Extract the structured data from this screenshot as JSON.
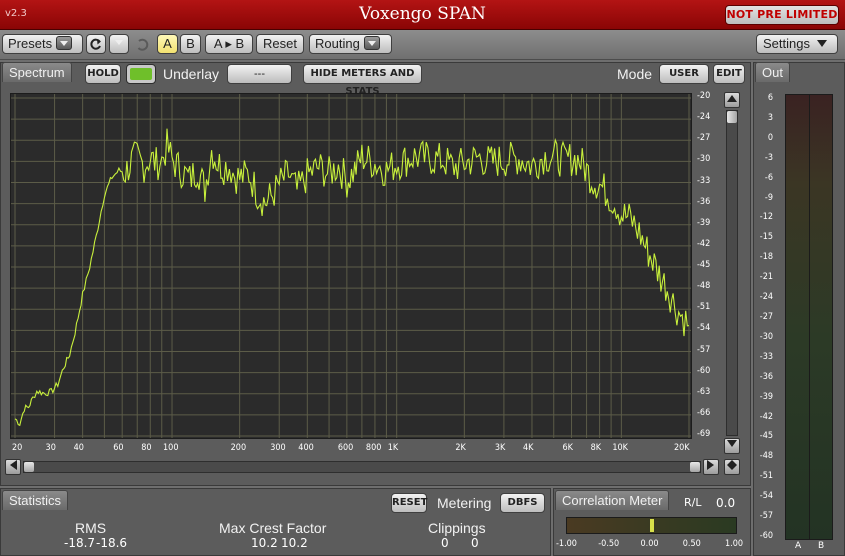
{
  "title_bar": {
    "version": "v2.3",
    "title": "Voxengo SPAN",
    "badge": "NOT PRE LIMITED"
  },
  "toolbar": {
    "presets_label": "Presets",
    "a_label": "A",
    "b_label": "B",
    "atob_label": "A ▸ B",
    "reset_label": "Reset",
    "routing_label": "Routing",
    "settings_label": "Settings",
    "undo_icon": "undo-icon",
    "redo_icon": "redo-icon",
    "dropdown_icon": "chevron-down-icon",
    "active_preset_color": "#f2e170"
  },
  "spectrum": {
    "tab_label": "Spectrum",
    "hold_label": "HOLD",
    "hold_led_color": "#6fbf2a",
    "underlay_label": "Underlay",
    "underlay_value": "---",
    "hide_meters_label": "HIDE METERS AND STATS",
    "mode_label": "Mode",
    "user_label": "USER",
    "edit_label": "EDIT"
  },
  "out": {
    "tab_label": "Out",
    "scale": [
      "6",
      "3",
      "0",
      "-3",
      "-6",
      "-9",
      "-12",
      "-15",
      "-18",
      "-21",
      "-24",
      "-27",
      "-30",
      "-33",
      "-36",
      "-39",
      "-42",
      "-45",
      "-48",
      "-51",
      "-54",
      "-57",
      "-60"
    ],
    "channel_labels": [
      "A",
      "B"
    ]
  },
  "statistics": {
    "tab_label": "Statistics",
    "reset_label": "RESET",
    "metering_label": "Metering",
    "metering_value": "DBFS",
    "rms_label": "RMS",
    "rms_values": [
      "-18.7",
      "-18.6"
    ],
    "crest_label": "Max Crest Factor",
    "crest_values": [
      "10.2",
      "10.2"
    ],
    "clip_label": "Clippings",
    "clip_values": [
      "0",
      "0"
    ]
  },
  "correlation": {
    "tab_label": "Correlation Meter",
    "rl_label": "R/L",
    "rl_value": "0.0",
    "correlation_value": 0.0,
    "scale": [
      "-1.00",
      "-0.50",
      "0.00",
      "0.50",
      "1.00"
    ],
    "indicator_color": "#d8e04a"
  },
  "chart_data": {
    "type": "line",
    "xscale": "log",
    "xlim": [
      20,
      20000
    ],
    "ylim": [
      -69,
      -20
    ],
    "grid": true,
    "line_color": "#c8f03c",
    "x_ticks": [
      {
        "v": 20,
        "label": "20"
      },
      {
        "v": 30,
        "label": "30"
      },
      {
        "v": 40,
        "label": "40"
      },
      {
        "v": 60,
        "label": "60"
      },
      {
        "v": 80,
        "label": "80"
      },
      {
        "v": 100,
        "label": "100"
      },
      {
        "v": 200,
        "label": "200"
      },
      {
        "v": 300,
        "label": "300"
      },
      {
        "v": 400,
        "label": "400"
      },
      {
        "v": 600,
        "label": "600"
      },
      {
        "v": 800,
        "label": "800"
      },
      {
        "v": 1000,
        "label": "1K"
      },
      {
        "v": 2000,
        "label": "2K"
      },
      {
        "v": 3000,
        "label": "3K"
      },
      {
        "v": 4000,
        "label": "4K"
      },
      {
        "v": 6000,
        "label": "6K"
      },
      {
        "v": 8000,
        "label": "8K"
      },
      {
        "v": 10000,
        "label": "10K"
      },
      {
        "v": 20000,
        "label": "20K"
      }
    ],
    "y_ticks": [
      "-20",
      "-24",
      "-27",
      "-30",
      "-33",
      "-36",
      "-39",
      "-42",
      "-45",
      "-48",
      "-51",
      "-54",
      "-57",
      "-60",
      "-63",
      "-66",
      "-69"
    ],
    "series": [
      {
        "x": [
          20,
          21,
          22,
          23,
          24,
          25,
          27,
          29,
          31,
          33,
          35,
          37,
          40,
          43,
          46,
          50,
          54,
          58,
          62,
          66,
          70,
          75,
          80,
          85,
          90,
          95,
          100,
          110,
          120,
          130,
          140,
          150,
          160,
          170,
          180,
          190,
          200,
          220,
          240,
          260,
          280,
          300,
          330,
          360,
          400,
          450,
          500,
          550,
          600,
          650,
          700,
          800,
          900,
          1000,
          1200,
          1400,
          1600,
          1800,
          2000,
          2300,
          2600,
          3000,
          3500,
          4000,
          4500,
          5000,
          5500,
          6000,
          6500,
          7000,
          7500,
          8000,
          8500,
          9000,
          9500,
          10000,
          11000,
          12000,
          13000,
          14000,
          15000,
          16000,
          17000,
          18000,
          19000,
          20000
        ],
        "y": [
          -66.5,
          -67.2,
          -65.0,
          -64.8,
          -63.5,
          -62.5,
          -62.8,
          -62.6,
          -61.5,
          -59.0,
          -57.2,
          -54.0,
          -48.5,
          -44.5,
          -40.0,
          -34.0,
          -31.5,
          -30.5,
          -30.8,
          -29.2,
          -28.5,
          -29.8,
          -28.7,
          -29.5,
          -29.0,
          -27.0,
          -29.0,
          -30.5,
          -31.8,
          -30.2,
          -33.2,
          -27.5,
          -29.5,
          -30.0,
          -29.8,
          -31.2,
          -31.6,
          -31.0,
          -33.8,
          -35.2,
          -34.0,
          -32.5,
          -31.0,
          -33.5,
          -31.2,
          -30.0,
          -31.0,
          -29.8,
          -32.0,
          -30.5,
          -28.5,
          -29.5,
          -30.5,
          -29.5,
          -28.5,
          -28.8,
          -29.0,
          -30.0,
          -29.5,
          -28.6,
          -29.3,
          -29.0,
          -28.7,
          -29.8,
          -28.5,
          -28.4,
          -29.0,
          -28.8,
          -29.0,
          -30.5,
          -32.0,
          -32.5,
          -33.5,
          -34.5,
          -35.5,
          -36.8,
          -37.5,
          -39.5,
          -42.0,
          -44.0,
          -46.0,
          -47.5,
          -49.5,
          -51.0,
          -52.0,
          -53.0
        ]
      }
    ]
  }
}
